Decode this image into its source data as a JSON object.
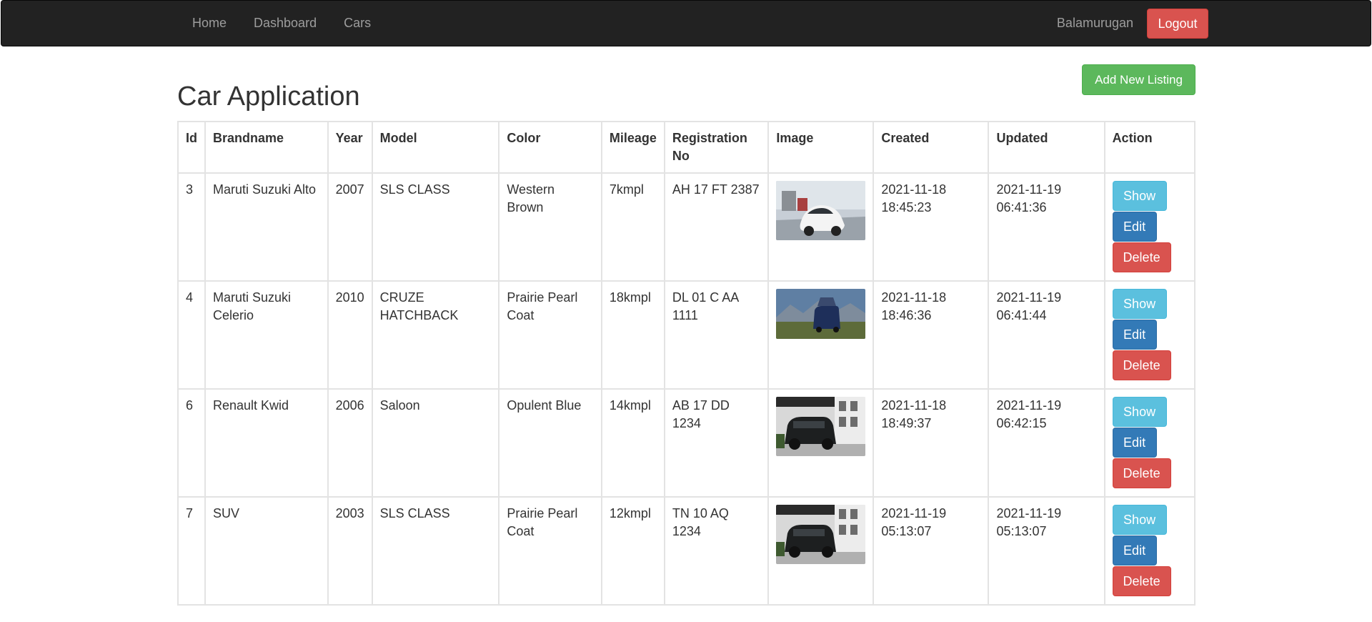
{
  "nav": {
    "links": [
      "Home",
      "Dashboard",
      "Cars"
    ],
    "user": "Balamurugan",
    "logout_label": "Logout"
  },
  "page": {
    "title": "Car Application",
    "add_label": "Add New Listing"
  },
  "table": {
    "headers": [
      "Id",
      "Brandname",
      "Year",
      "Model",
      "Color",
      "Mileage",
      "Registration No",
      "Image",
      "Created",
      "Updated",
      "Action"
    ],
    "rows": [
      {
        "id": "3",
        "brand": "Maruti Suzuki Alto",
        "year": "2007",
        "model": "SLS CLASS",
        "color": "Western Brown",
        "mileage": "7kmpl",
        "reg": "AH 17 FT 2387",
        "created_date": "2021-11-18",
        "created_time": "18:45:23",
        "updated_date": "2021-11-19",
        "updated_time": "06:41:36"
      },
      {
        "id": "4",
        "brand": "Maruti Suzuki Celerio",
        "year": "2010",
        "model": "CRUZE HATCHBACK",
        "color": "Prairie Pearl Coat",
        "mileage": "18kmpl",
        "reg": "DL 01 C AA 1111",
        "created_date": "2021-11-18",
        "created_time": "18:46:36",
        "updated_date": "2021-11-19",
        "updated_time": "06:41:44"
      },
      {
        "id": "6",
        "brand": "Renault Kwid",
        "year": "2006",
        "model": "Saloon",
        "color": "Opulent Blue",
        "mileage": "14kmpl",
        "reg": "AB 17 DD 1234",
        "created_date": "2021-11-18",
        "created_time": "18:49:37",
        "updated_date": "2021-11-19",
        "updated_time": "06:42:15"
      },
      {
        "id": "7",
        "brand": "SUV",
        "year": "2003",
        "model": "SLS CLASS",
        "color": "Prairie Pearl Coat",
        "mileage": "12kmpl",
        "reg": "TN 10 AQ 1234",
        "created_date": "2021-11-19",
        "created_time": "05:13:07",
        "updated_date": "2021-11-19",
        "updated_time": "05:13:07"
      }
    ],
    "actions": {
      "show": "Show",
      "edit": "Edit",
      "delete": "Delete"
    }
  },
  "colors": {
    "navbar": "#222222",
    "success": "#5cb85c",
    "info": "#5bc0de",
    "primary": "#337ab7",
    "danger": "#d9534f"
  }
}
